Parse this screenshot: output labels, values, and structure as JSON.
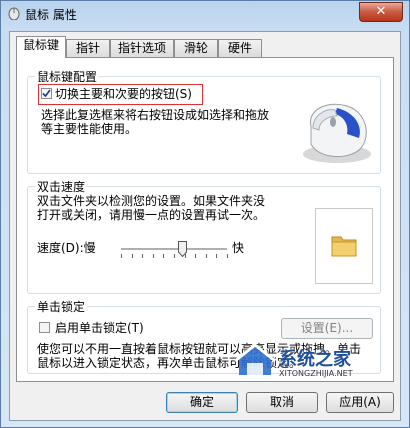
{
  "window": {
    "title": "鼠标 属性",
    "close_label": "✕"
  },
  "tabs": [
    {
      "label": "鼠标键",
      "active": true
    },
    {
      "label": "指针",
      "active": false
    },
    {
      "label": "指针选项",
      "active": false
    },
    {
      "label": "滑轮",
      "active": false
    },
    {
      "label": "硬件",
      "active": false
    }
  ],
  "button_config": {
    "group_title": "鼠标键配置",
    "switch_checkbox_label": "切换主要和次要的按钮(S)",
    "switch_checked": true,
    "description_line1": "选择此复选框来将右按钮设成如选择和拖放",
    "description_line2": "等主要性能使用。"
  },
  "double_click": {
    "group_title": "双击速度",
    "description_line1": "双击文件夹以检测您的设置。如果文件夹没",
    "description_line2": "打开或关闭，请用慢一点的设置再试一次。",
    "speed_label": "速度(D):慢",
    "fast_label": "快",
    "speed_level": 0.58
  },
  "click_lock": {
    "group_title": "单击锁定",
    "enable_checkbox_label": "启用单击锁定(T)",
    "enable_checked": false,
    "settings_button": "设置(E)...",
    "description_line1": "使您可以不用一直按着鼠标按钮就可以高亮显示或拖拽。单击",
    "description_line2": "鼠标以进入锁定状态，再次单击鼠标可解除锁定。"
  },
  "footer": {
    "ok": "确定",
    "cancel": "取消",
    "apply": "应用(A)"
  },
  "watermark": {
    "brand": "系统之家",
    "domain": "XITONGZHIJIA.NET"
  },
  "colors": {
    "accent": "#3c7fb1",
    "highlight_box": "#e03030",
    "close_button": "#c75a40"
  }
}
